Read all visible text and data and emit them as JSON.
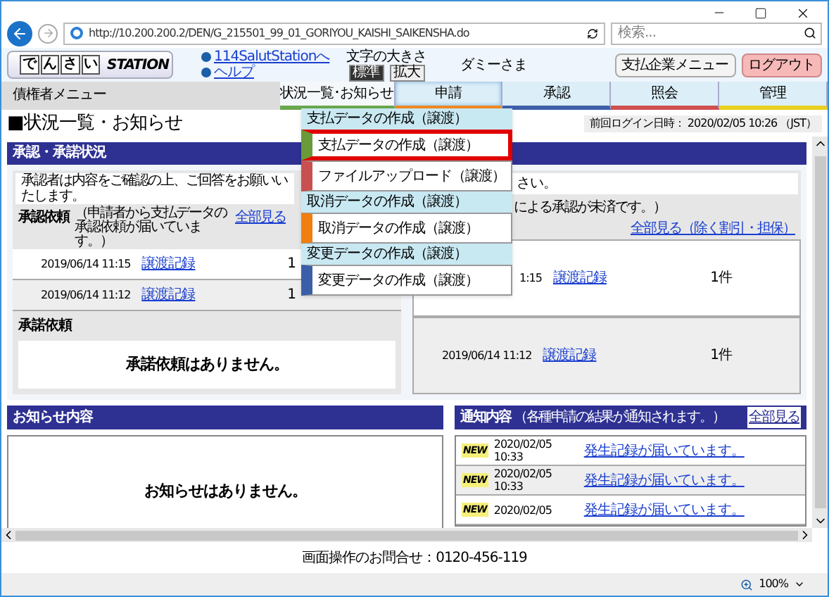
{
  "browser": {
    "url": "http://10.200.200.2/DEN/G_215501_99_01_GORIYOU_KAISHI_SAIKENSHA.do",
    "search_placeholder": "検索...",
    "zoom": "100%"
  },
  "header": {
    "logo_chars": [
      "で",
      "ん",
      "さ",
      "い"
    ],
    "logo_word": "STATION",
    "links": [
      "114SalutStationへ",
      "ヘルプ"
    ],
    "font_size_label": "文字の大きさ",
    "font_sizes": [
      {
        "label": "標準",
        "selected": true
      },
      {
        "label": "拡大",
        "selected": false
      }
    ],
    "user": "ダミーさま",
    "buttons": [
      {
        "label": "支払企業メニュー",
        "kind": "normal"
      },
      {
        "label": "ログアウト",
        "kind": "logout"
      }
    ]
  },
  "nav": {
    "menu_title": "債権者メニュー",
    "tabs": [
      {
        "label": "状況一覧･お知らせ",
        "selected": true,
        "expanded": false,
        "color": "#6aa84f"
      },
      {
        "label": "申請",
        "selected": false,
        "expanded": true,
        "color": "#f08a24"
      },
      {
        "label": "承認",
        "selected": false,
        "expanded": false,
        "color": "#3f5fa8"
      },
      {
        "label": "照会",
        "selected": false,
        "expanded": false,
        "color": "#d05050"
      },
      {
        "label": "管理",
        "selected": false,
        "expanded": false,
        "color": "#e8d020"
      }
    ]
  },
  "dropdown": {
    "groups": [
      {
        "title": "支払データの作成（譲渡）",
        "items": [
          {
            "label": "支払データの作成（譲渡）",
            "color": "#6a9a3a",
            "selected": true
          },
          {
            "label": "ファイルアップロード（譲渡）",
            "color": "#c85050",
            "selected": false
          }
        ]
      },
      {
        "title": "取消データの作成（譲渡）",
        "items": [
          {
            "label": "取消データの作成（譲渡）",
            "color": "#f07f10",
            "selected": false
          }
        ]
      },
      {
        "title": "変更データの作成（譲渡）",
        "items": [
          {
            "label": "変更データの作成（譲渡）",
            "color": "#3a5fa8",
            "selected": false
          }
        ]
      }
    ]
  },
  "page": {
    "title": "■状況一覧・お知らせ",
    "last_login": "前回ログイン日時： 2020/02/05 10:26 （JST）"
  },
  "approval": {
    "title": "承認・承諾状況",
    "left": {
      "notice": "承認者は内容をご確認の上、ご回答をお願いいたします。",
      "request_title": "承認依頼",
      "request_note": "（申請者から支払データの承認依頼が届いています。）",
      "view_all": "全部見る",
      "rows": [
        {
          "date": "2019/06/14 11:15",
          "link": "譲渡記録",
          "count": "1"
        },
        {
          "date": "2019/06/14 11:12",
          "link": "譲渡記録",
          "count": "1"
        }
      ],
      "consent_title": "承諾依頼",
      "consent_empty": "承諾依頼はありません。"
    },
    "right": {
      "notice": "さい。",
      "request_note": "による承認が未済です。）",
      "view_all": "全部見る（除く割引・担保）",
      "rows": [
        {
          "date": "1:15",
          "link": "譲渡記録",
          "count": "1件"
        },
        {
          "date": "2019/06/14 11:12",
          "link": "譲渡記録",
          "count": "1件"
        }
      ]
    }
  },
  "notices": {
    "title": "お知らせ内容",
    "empty": "お知らせはありません。"
  },
  "notifications": {
    "title": "通知内容",
    "note": "（各種申請の結果が通知されます。）",
    "view_all": "全部見る",
    "items": [
      {
        "badge": "NEW",
        "date": "2020/02/05",
        "time": "10:33",
        "link": "発生記録が届いています。"
      },
      {
        "badge": "NEW",
        "date": "2020/02/05",
        "time": "10:33",
        "link": "発生記録が届いています。"
      },
      {
        "badge": "NEW",
        "date": "2020/02/05",
        "link": "発生記録が届いています。"
      }
    ]
  },
  "footer": "画面操作のお問合せ：0120-456-119"
}
